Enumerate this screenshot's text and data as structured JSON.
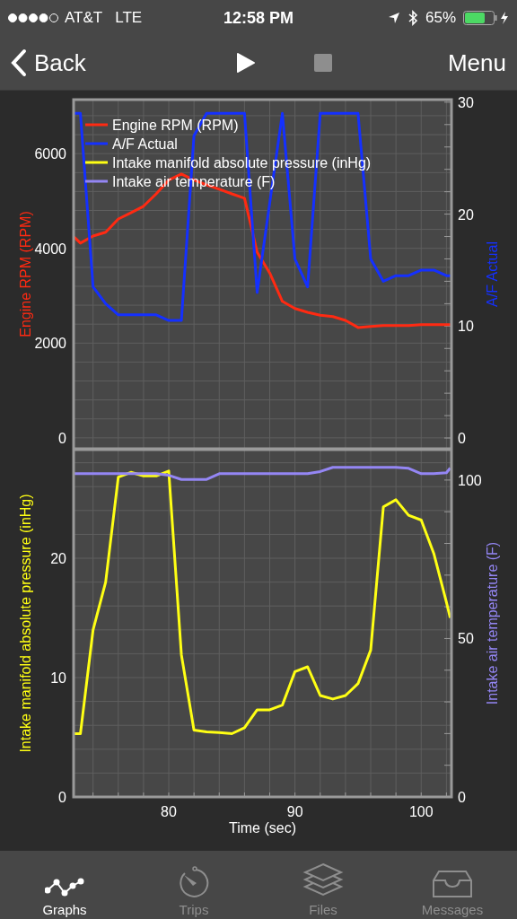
{
  "status_bar": {
    "carrier": "AT&T",
    "network": "LTE",
    "time": "12:58 PM",
    "battery": "65%"
  },
  "nav_bar": {
    "back": "Back",
    "controls": [
      {
        "kind": "play",
        "disabled": false
      },
      {
        "kind": "stop",
        "disabled": true
      }
    ],
    "menu": "Menu"
  },
  "charts": [
    {
      "chart_data": {
        "type": "line",
        "grid": true,
        "legend": true,
        "ylabel": "Engine RPM (RPM)",
        "y2label": "A/F Actual",
        "xlim": [
          72.46,
          102.4
        ],
        "ylim": [
          -230,
          7140
        ],
        "y2lim": [
          -0.96,
          30.23
        ],
        "yticks": [
          0,
          2000,
          4000,
          6000
        ],
        "y2ticks": [
          0,
          10,
          20,
          30
        ],
        "x": [
          72.5,
          73,
          74,
          75,
          76,
          77,
          78,
          79,
          80,
          81,
          82,
          83,
          84,
          85,
          86,
          87,
          88,
          89,
          90,
          91,
          92,
          93,
          94,
          95,
          96,
          97,
          98,
          99,
          100,
          101,
          102,
          102.3
        ],
        "series": [
          {
            "name": "Engine RPM (RPM)",
            "color": "#ff2a12",
            "axis": "y",
            "values": [
              4240,
              4110,
              4260,
              4340,
              4620,
              4750,
              4890,
              5150,
              5440,
              5570,
              5440,
              5340,
              5250,
              5150,
              5060,
              3920,
              3480,
              2880,
              2730,
              2650,
              2590,
              2560,
              2480,
              2330,
              2350,
              2370,
              2370,
              2370,
              2390,
              2390,
              2390,
              2390
            ]
          },
          {
            "name": "A/F Actual",
            "color": "#1430ff",
            "axis": "y2",
            "values": [
              29,
              29,
              13.5,
              12,
              11,
              11,
              11,
              11,
              10.5,
              10.5,
              27,
              29,
              29,
              29,
              29,
              13,
              21,
              29,
              16,
              13.5,
              29,
              29,
              29,
              29,
              16,
              14,
              14.5,
              14.5,
              15,
              15,
              14.5,
              14.5
            ]
          }
        ]
      }
    },
    {
      "chart_data": {
        "type": "line",
        "grid": true,
        "xlabel": "Time (sec)",
        "ylabel": "Intake manifold absolute pressure (inHg)",
        "y2label": "Intake air temperature (F)",
        "xlim": [
          72.46,
          102.4
        ],
        "ylim": [
          0,
          29.1
        ],
        "y2lim": [
          0,
          109.6
        ],
        "xticks": [
          80,
          90,
          100
        ],
        "yticks": [
          0,
          10,
          20
        ],
        "y2ticks": [
          0,
          50,
          100
        ],
        "x": [
          72.5,
          73,
          74,
          75,
          76,
          77,
          78,
          79,
          80,
          81,
          82,
          83,
          84,
          85,
          86,
          87,
          88,
          89,
          90,
          91,
          92,
          93,
          94,
          95,
          96,
          97,
          98,
          99,
          100,
          101,
          102,
          102.3
        ],
        "series": [
          {
            "name": "Intake manifold absolute pressure (inHg)",
            "color": "#ffff14",
            "axis": "y",
            "values": [
              5.3,
              5.3,
              14.0,
              18.0,
              26.8,
              27.2,
              26.9,
              26.9,
              27.3,
              11.9,
              5.6,
              5.45,
              5.4,
              5.3,
              5.8,
              7.3,
              7.3,
              7.7,
              10.5,
              10.9,
              8.5,
              8.2,
              8.5,
              9.5,
              12.3,
              24.3,
              24.9,
              23.6,
              23.2,
              20.4,
              16.3,
              15.0
            ]
          },
          {
            "name": "Intake air temperature (F)",
            "color": "#9486f4",
            "axis": "y2",
            "values": [
              102,
              102,
              102,
              102,
              102,
              102,
              102,
              102,
              101.5,
              100.2,
              100.2,
              100.2,
              102,
              102,
              102,
              102,
              102,
              102,
              102,
              102,
              102.7,
              104,
              104,
              104,
              104,
              104,
              104,
              103.7,
              102,
              102,
              102.3,
              103.8
            ]
          }
        ]
      }
    }
  ],
  "tab_bar": [
    {
      "label": "Graphs",
      "selected": true
    },
    {
      "label": "Trips",
      "selected": false
    },
    {
      "label": "Files",
      "selected": false
    },
    {
      "label": "Messages",
      "selected": false
    }
  ]
}
